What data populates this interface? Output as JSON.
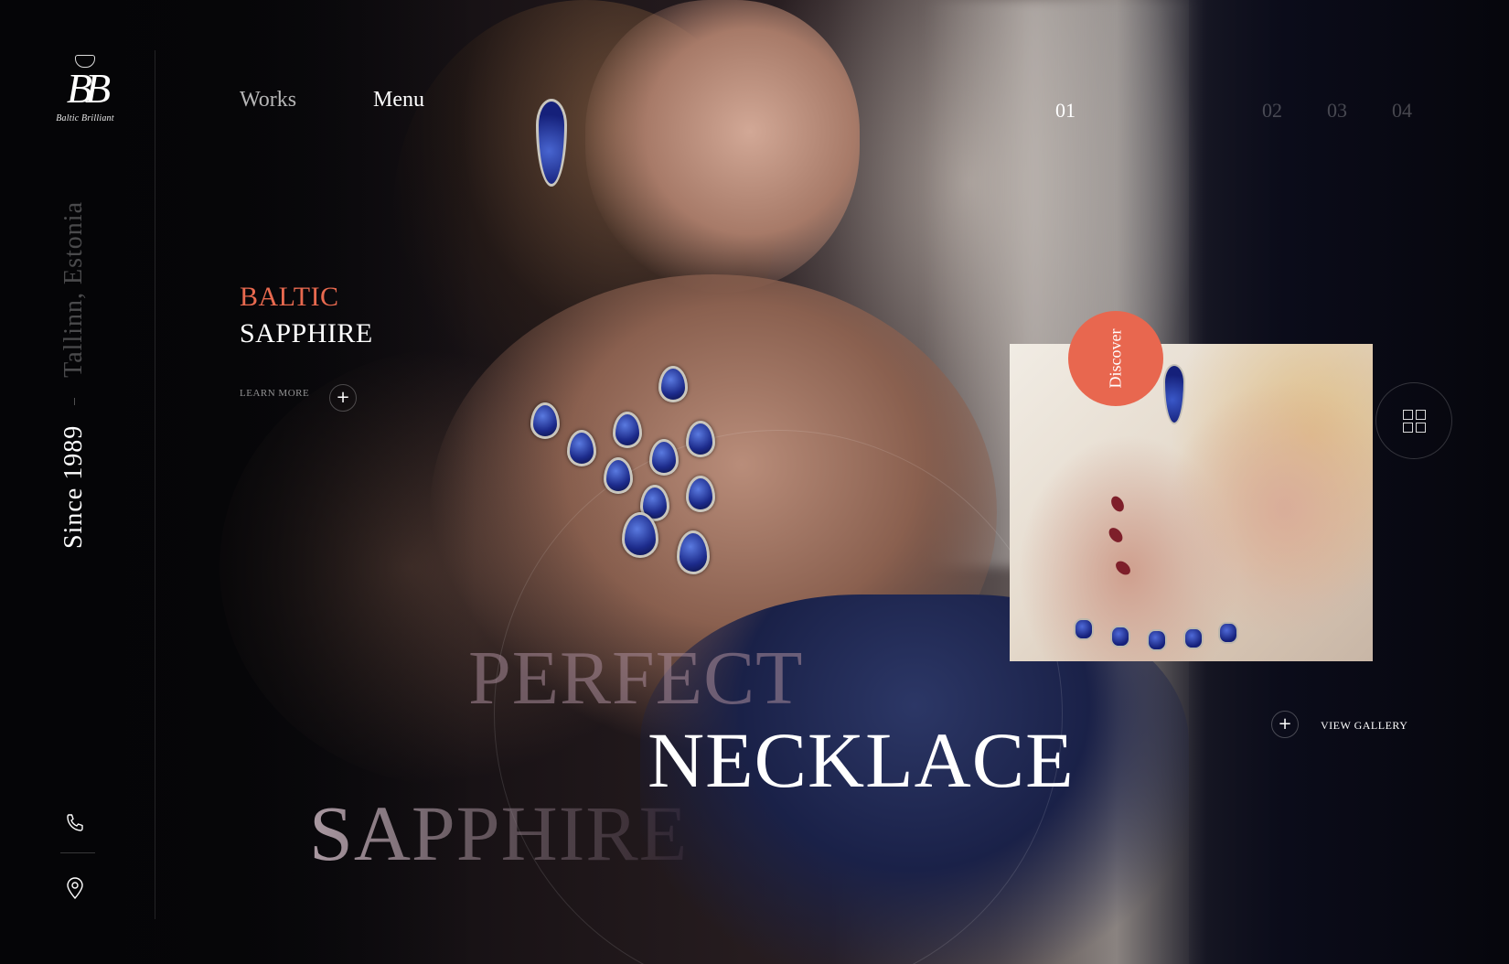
{
  "brand": {
    "monogram": "BB",
    "name": "Baltic Brilliant"
  },
  "sidebar": {
    "since": "Since 1989",
    "location": "Tallinn, Estonia",
    "icons": [
      "phone-icon",
      "location-pin-icon"
    ]
  },
  "nav": {
    "works": "Works",
    "menu": "Menu"
  },
  "slides": [
    {
      "label": "01",
      "active": true
    },
    {
      "label": "02",
      "active": false
    },
    {
      "label": "03",
      "active": false
    },
    {
      "label": "04",
      "active": false
    }
  ],
  "hero": {
    "eyebrow": "BALTIC",
    "subtitle": "SAPPHIRE",
    "learn_more": "LEARN MORE",
    "headline_1": "PERFECT",
    "headline_2": "NECKLACE",
    "headline_3": "SAPPHIRE"
  },
  "card": {
    "discover": "Discover"
  },
  "gallery": {
    "view_gallery": "VIEW GALLERY"
  },
  "colors": {
    "accent": "#e8674f",
    "background": "#07070b",
    "sapphire": "#1c2a8a"
  }
}
